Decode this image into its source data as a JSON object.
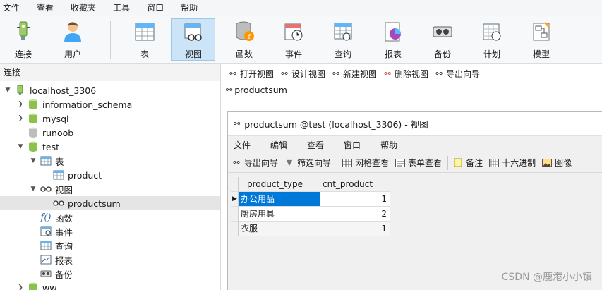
{
  "menubar": [
    "文件",
    "查看",
    "收藏夹",
    "工具",
    "窗口",
    "帮助"
  ],
  "toolbar": [
    {
      "label": "连接",
      "icon": "connection-icon"
    },
    {
      "label": "用户",
      "icon": "user-icon"
    },
    {
      "label": "表",
      "icon": "table-icon"
    },
    {
      "label": "视图",
      "icon": "view-icon",
      "active": true
    },
    {
      "label": "函数",
      "icon": "function-icon"
    },
    {
      "label": "事件",
      "icon": "event-icon"
    },
    {
      "label": "查询",
      "icon": "query-icon"
    },
    {
      "label": "报表",
      "icon": "report-icon"
    },
    {
      "label": "备份",
      "icon": "backup-icon"
    },
    {
      "label": "计划",
      "icon": "schedule-icon"
    },
    {
      "label": "模型",
      "icon": "model-icon"
    }
  ],
  "left_header": "连接",
  "tree": [
    {
      "label": "localhost_3306",
      "icon": "server-icon"
    },
    {
      "label": "information_schema",
      "icon": "database-icon"
    },
    {
      "label": "mysql",
      "icon": "database-icon"
    },
    {
      "label": "runoob",
      "icon": "database-icon"
    },
    {
      "label": "test",
      "icon": "database-icon"
    },
    {
      "label": "表",
      "icon": "table-folder-icon"
    },
    {
      "label": "product",
      "icon": "table-icon"
    },
    {
      "label": "视图",
      "icon": "view-folder-icon"
    },
    {
      "label": "productsum",
      "icon": "view-icon"
    },
    {
      "label": "函数",
      "icon": "function-icon"
    },
    {
      "label": "事件",
      "icon": "event-icon"
    },
    {
      "label": "查询",
      "icon": "query-icon"
    },
    {
      "label": "报表",
      "icon": "report-icon"
    },
    {
      "label": "备份",
      "icon": "backup-icon"
    },
    {
      "label": "ww",
      "icon": "database-icon"
    }
  ],
  "object_toolbar": [
    "打开视图",
    "设计视图",
    "新建视图",
    "删除视图",
    "导出向导"
  ],
  "object_item": "productsum",
  "view_window": {
    "title": "productsum @test (localhost_3306) - 视图",
    "menu": [
      "文件",
      "编辑",
      "查看",
      "窗口",
      "帮助"
    ],
    "toolbar": [
      "导出向导",
      "筛选向导",
      "网格查看",
      "表单查看",
      "备注",
      "十六进制",
      "图像"
    ]
  },
  "grid": {
    "columns": [
      "product_type",
      "cnt_product"
    ],
    "rows": [
      [
        "办公用品",
        "1"
      ],
      [
        "厨房用具",
        "2"
      ],
      [
        "衣服",
        "1"
      ]
    ]
  },
  "watermark": "CSDN @鹿港小小镇",
  "colors": {
    "selection": "#0078d7",
    "active_tool": "#cce4f7",
    "db_green": "#8bc34a"
  }
}
